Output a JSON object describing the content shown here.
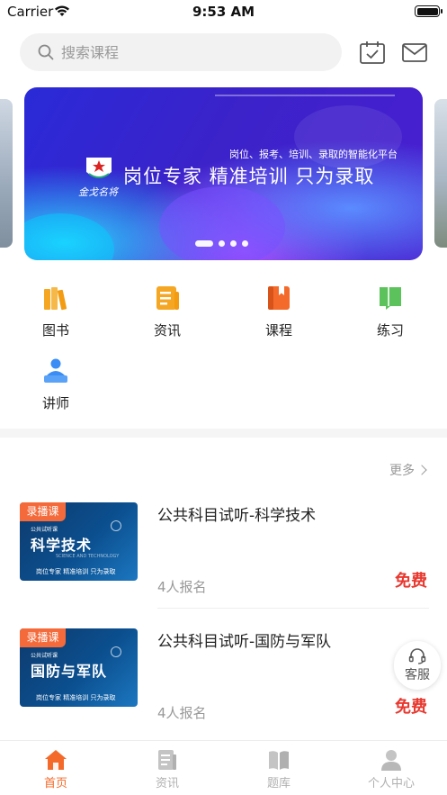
{
  "status_bar": {
    "carrier": "Carrier",
    "time": "9:53 AM"
  },
  "search": {
    "placeholder": "搜索课程"
  },
  "banner": {
    "tagline": "岗位、报考、培训、录取的智能化平台",
    "headline": "岗位专家  精准培训  只为录取",
    "seal_text": "金戈名将",
    "slides": 4,
    "active_slide": 1
  },
  "menu": [
    {
      "label": "图书",
      "icon": "books-icon",
      "color": "#f5a623"
    },
    {
      "label": "资讯",
      "icon": "news-icon",
      "color": "#f5a623"
    },
    {
      "label": "课程",
      "icon": "course-icon",
      "color": "#f46a2a"
    },
    {
      "label": "练习",
      "icon": "practice-icon",
      "color": "#5cc25c"
    },
    {
      "label": "讲师",
      "icon": "lecturer-icon",
      "color": "#3a8df5"
    }
  ],
  "more_label": "更多",
  "courses": [
    {
      "title": "公共科目试听-科学技术",
      "tag": "录播课",
      "thumb_small": "公共试听课",
      "thumb_title": "科学技术",
      "thumb_en": "SCIENCE AND TECHNOLOGY",
      "thumb_foot": "岗位专家  精准培训  只为录取",
      "enrolled": "4人报名",
      "price": "免费"
    },
    {
      "title": "公共科目试听-国防与军队",
      "tag": "录播课",
      "thumb_small": "公共试听课",
      "thumb_title": "国防与军队",
      "thumb_en": "",
      "thumb_foot": "岗位专家  精准培训  只为录取",
      "enrolled": "4人报名",
      "price": "免费"
    }
  ],
  "service_label": "客服",
  "tabs": [
    {
      "label": "首页",
      "active": true
    },
    {
      "label": "资讯",
      "active": false
    },
    {
      "label": "题库",
      "active": false
    },
    {
      "label": "个人中心",
      "active": false
    }
  ],
  "colors": {
    "accent": "#f46a2a",
    "price": "#e8382f",
    "tag": "#f46a3a"
  }
}
